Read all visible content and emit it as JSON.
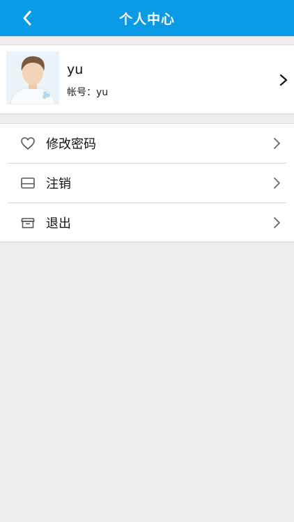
{
  "header": {
    "title": "个人中心",
    "back_icon": "chevron-left-icon",
    "color": "#0a9ae6"
  },
  "profile": {
    "name": "yu",
    "account_label": "帐号：",
    "account_value": "yu",
    "avatar_icon": "user-avatar",
    "chevron_icon": "chevron-right-icon"
  },
  "menu": {
    "items": [
      {
        "label": "修改密码",
        "icon": "heart-icon"
      },
      {
        "label": "注销",
        "icon": "card-icon"
      },
      {
        "label": "退出",
        "icon": "box-icon"
      }
    ],
    "chevron_icon": "chevron-right-icon"
  },
  "colors": {
    "background": "#ededed",
    "card": "#ffffff",
    "divider": "#d4d4d4"
  }
}
